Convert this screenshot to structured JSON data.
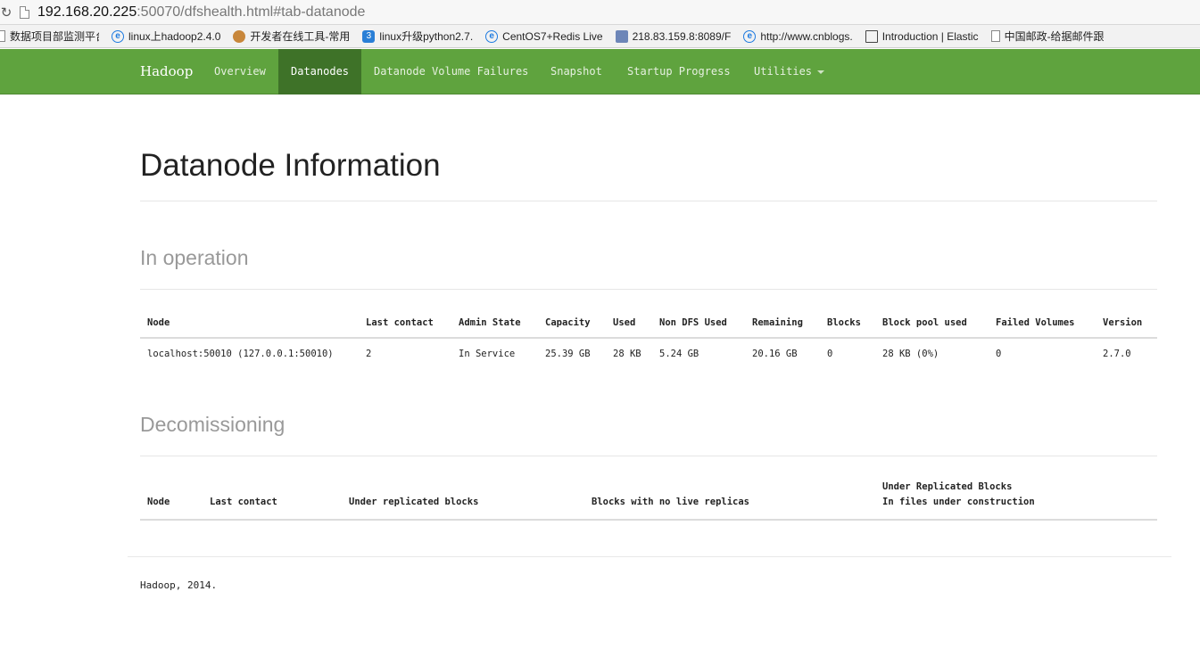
{
  "browser": {
    "url_host": "192.168.20.225",
    "url_rest": ":50070/dfshealth.html#tab-datanode",
    "bookmarks": [
      {
        "label": "数据项目部监测平台",
        "icon": "page-icon"
      },
      {
        "label": "linux上hadoop2.4.0",
        "icon": "ie-icon"
      },
      {
        "label": "开发者在线工具-常用",
        "icon": "monkey-icon"
      },
      {
        "label": "linux升级python2.7.",
        "icon": "s3-icon"
      },
      {
        "label": "CentOS7+Redis Live",
        "icon": "ie-icon"
      },
      {
        "label": "218.83.159.8:8089/F",
        "icon": "box-icon"
      },
      {
        "label": "http://www.cnblogs.",
        "icon": "ie-icon"
      },
      {
        "label": "Introduction | Elastic",
        "icon": "book-icon"
      },
      {
        "label": "中国邮政-给据邮件跟",
        "icon": "page-icon"
      }
    ]
  },
  "nav": {
    "brand": "Hadoop",
    "items": [
      {
        "label": "Overview",
        "active": false
      },
      {
        "label": "Datanodes",
        "active": true
      },
      {
        "label": "Datanode Volume Failures",
        "active": false
      },
      {
        "label": "Snapshot",
        "active": false
      },
      {
        "label": "Startup Progress",
        "active": false
      },
      {
        "label": "Utilities",
        "active": false
      }
    ]
  },
  "page": {
    "title": "Datanode Information",
    "in_operation": {
      "heading": "In operation",
      "columns": [
        "Node",
        "Last contact",
        "Admin State",
        "Capacity",
        "Used",
        "Non DFS Used",
        "Remaining",
        "Blocks",
        "Block pool used",
        "Failed Volumes",
        "Version"
      ],
      "rows": [
        [
          "localhost:50010 (127.0.0.1:50010)",
          "2",
          "In Service",
          "25.39 GB",
          "28 KB",
          "5.24 GB",
          "20.16 GB",
          "0",
          "28 KB (0%)",
          "0",
          "2.7.0"
        ]
      ]
    },
    "decommissioning": {
      "heading": "Decomissioning",
      "columns": [
        "Node",
        "Last contact",
        "Under replicated blocks",
        "Blocks with no live replicas",
        "Under Replicated Blocks\nIn files under construction"
      ]
    },
    "footer": "Hadoop, 2014."
  },
  "colors": {
    "navbar": "#5fa33e",
    "navbar_active": "#3e7228",
    "section_heading": "#999999"
  }
}
